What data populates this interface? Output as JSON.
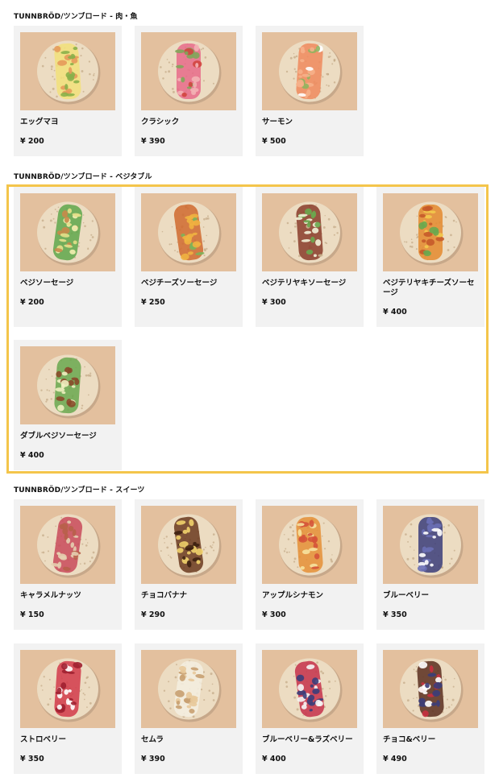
{
  "highlight_color": "#f4c54b",
  "sections": [
    {
      "title": "TUNNBRÖD/ツンブロード - 肉・魚",
      "items": [
        {
          "name": "エッグマヨ",
          "price": "¥ 200",
          "photo_icon": "egg-mayo-wrap-icon"
        },
        {
          "name": "クラシック",
          "price": "¥ 390",
          "photo_icon": "classic-wrap-icon"
        },
        {
          "name": "サーモン",
          "price": "¥ 500",
          "photo_icon": "salmon-wrap-icon"
        }
      ]
    },
    {
      "title": "TUNNBRÖD/ツンブロード - ベジタブル",
      "items": [
        {
          "name": "ベジソーセージ",
          "price": "¥ 200",
          "photo_icon": "veg-sausage-wrap-icon"
        },
        {
          "name": "ベジチーズソーセージ",
          "price": "¥ 250",
          "photo_icon": "veg-cheese-sausage-wrap-icon"
        },
        {
          "name": "ベジテリヤキソーセージ",
          "price": "¥ 300",
          "photo_icon": "veg-teriyaki-sausage-wrap-icon"
        },
        {
          "name": "ベジテリヤキチーズソーセージ",
          "price": "¥ 400",
          "photo_icon": "veg-teriyaki-cheese-sausage-wrap-icon"
        },
        {
          "name": "ダブルベジソーセージ",
          "price": "¥ 400",
          "photo_icon": "double-veg-sausage-wrap-icon"
        }
      ]
    },
    {
      "title": "TUNNBRÖD/ツンブロード - スイーツ",
      "items": [
        {
          "name": "キャラメルナッツ",
          "price": "¥ 150",
          "photo_icon": "caramel-nuts-wrap-icon"
        },
        {
          "name": "チョコバナナ",
          "price": "¥ 290",
          "photo_icon": "choco-banana-wrap-icon"
        },
        {
          "name": "アップルシナモン",
          "price": "¥ 300",
          "photo_icon": "apple-cinnamon-wrap-icon"
        },
        {
          "name": "ブルーベリー",
          "price": "¥ 350",
          "photo_icon": "blueberry-wrap-icon"
        },
        {
          "name": "ストロベリー",
          "price": "¥ 350",
          "photo_icon": "strawberry-wrap-icon"
        },
        {
          "name": "セムラ",
          "price": "¥ 390",
          "photo_icon": "semla-wrap-icon"
        },
        {
          "name": "ブルーベリー&ラズベリー",
          "price": "¥ 400",
          "photo_icon": "blueberry-raspberry-wrap-icon"
        },
        {
          "name": "チョコ&ベリー",
          "price": "¥ 490",
          "photo_icon": "choco-berry-wrap-icon"
        }
      ]
    }
  ]
}
